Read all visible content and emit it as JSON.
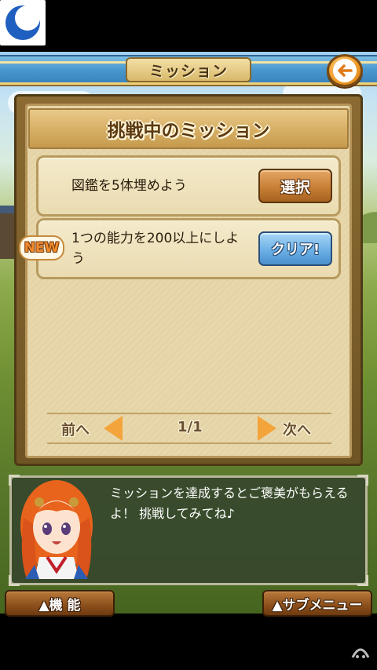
{
  "header": {
    "title": "ミッション"
  },
  "panel": {
    "title": "挑戦中のミッション"
  },
  "missions": [
    {
      "text": "図鑑を5体埋めよう",
      "action_label": "選択",
      "is_new": false
    },
    {
      "text": "1つの能力を200以上にしよう",
      "action_label": "クリア!",
      "is_new": true,
      "badge": "NEW"
    }
  ],
  "pager": {
    "prev_label": "前へ",
    "next_label": "次へ",
    "page": "1/1"
  },
  "dialog": {
    "text": "ミッションを達成するとご褒美がもらえるよ！ 挑戦してみてね♪"
  },
  "bottom": {
    "left_label": "▲機 能",
    "right_label": "▲サブメニュー"
  },
  "colors": {
    "accent_orange": "#f3a43b",
    "select_button": "#c77f35",
    "clear_button": "#6cb0e6",
    "header_blue": "#4a98cf"
  },
  "icons": {
    "app": "moon-icon",
    "back": "back-arrow-icon",
    "watermark": "watermark-icon"
  }
}
